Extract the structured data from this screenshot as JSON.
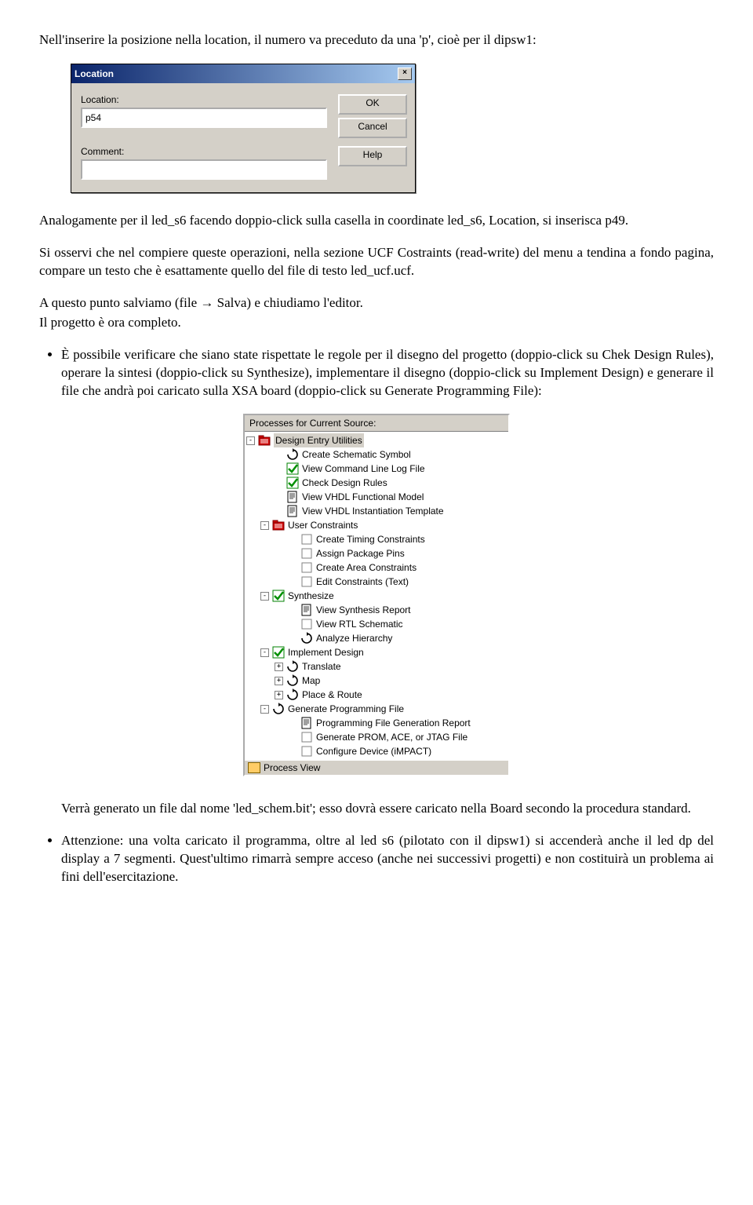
{
  "para1": "Nell'inserire la posizione nella location, il numero va preceduto da una 'p', cioè per il dipsw1:",
  "dialog": {
    "title": "Location",
    "loc_label": "Location:",
    "loc_value": "p54",
    "comment_label": "Comment:",
    "comment_value": "",
    "ok": "OK",
    "cancel": "Cancel",
    "help": "Help"
  },
  "para2": "Analogamente per il led_s6 facendo doppio-click sulla casella in coordinate led_s6, Location, si inserisca p49.",
  "para3": "Si osservi che nel compiere queste operazioni, nella sezione UCF Costraints (read-write) del menu a tendina a fondo pagina, compare un testo che è esattamente quello del file di testo led_ucf.ucf.",
  "para4": "A questo punto salviamo (file → Salva) e chiudiamo l'editor.",
  "para5": "Il progetto è ora completo.",
  "bullet1": "È possibile verificare che siano state rispettate le regole per il disegno del progetto (doppio-click su Chek Design Rules), operare la sintesi (doppio-click su Synthesize), implementare il disegno (doppio-click su Implement Design) e generare il file che andrà poi caricato sulla XSA board (doppio-click su Generate Programming File):",
  "panel": {
    "title": "Processes for Current Source:",
    "items": [
      {
        "pm": "-",
        "indent": 0,
        "icon": "folder",
        "text": "Design Entry Utilities",
        "sel": true
      },
      {
        "pm": "",
        "indent": 36,
        "icon": "cycle",
        "text": "Create Schematic Symbol"
      },
      {
        "pm": "",
        "indent": 36,
        "icon": "check",
        "text": "View Command Line Log File"
      },
      {
        "pm": "",
        "indent": 36,
        "icon": "check",
        "text": "Check Design Rules"
      },
      {
        "pm": "",
        "indent": 36,
        "icon": "doc",
        "text": "View VHDL Functional Model"
      },
      {
        "pm": "",
        "indent": 36,
        "icon": "doc",
        "text": "View VHDL Instantiation Template"
      },
      {
        "pm": "-",
        "indent": 18,
        "icon": "folder",
        "text": "User Constraints"
      },
      {
        "pm": "",
        "indent": 54,
        "icon": "blank",
        "text": "Create Timing Constraints"
      },
      {
        "pm": "",
        "indent": 54,
        "icon": "blank",
        "text": "Assign Package Pins"
      },
      {
        "pm": "",
        "indent": 54,
        "icon": "blank",
        "text": "Create Area Constraints"
      },
      {
        "pm": "",
        "indent": 54,
        "icon": "blank",
        "text": "Edit Constraints (Text)"
      },
      {
        "pm": "-",
        "indent": 18,
        "icon": "check",
        "text": "Synthesize"
      },
      {
        "pm": "",
        "indent": 54,
        "icon": "doc",
        "text": "View Synthesis Report"
      },
      {
        "pm": "",
        "indent": 54,
        "icon": "blank",
        "text": "View RTL Schematic"
      },
      {
        "pm": "",
        "indent": 54,
        "icon": "cycle",
        "text": "Analyze Hierarchy"
      },
      {
        "pm": "-",
        "indent": 18,
        "icon": "check",
        "text": "Implement Design"
      },
      {
        "pm": "+",
        "indent": 36,
        "icon": "cycle",
        "text": "Translate"
      },
      {
        "pm": "+",
        "indent": 36,
        "icon": "cycle",
        "text": "Map"
      },
      {
        "pm": "+",
        "indent": 36,
        "icon": "cycle",
        "text": "Place & Route"
      },
      {
        "pm": "-",
        "indent": 18,
        "icon": "cycle",
        "text": "Generate Programming File"
      },
      {
        "pm": "",
        "indent": 54,
        "icon": "doc",
        "text": "Programming File Generation Report"
      },
      {
        "pm": "",
        "indent": 54,
        "icon": "blank",
        "text": "Generate PROM, ACE, or JTAG File"
      },
      {
        "pm": "",
        "indent": 54,
        "icon": "blank",
        "text": "Configure Device (iMPACT)"
      }
    ],
    "status": "Process View"
  },
  "para6": "Verrà generato un file dal nome 'led_schem.bit'; esso dovrà essere caricato nella Board secondo la procedura standard.",
  "bullet2": "Attenzione: una volta caricato il programma, oltre al led s6 (pilotato con il dipsw1) si accenderà anche il led dp del display a 7 segmenti. Quest'ultimo rimarrà sempre acceso (anche nei successivi progetti) e non costituirà un problema ai fini dell'esercitazione."
}
